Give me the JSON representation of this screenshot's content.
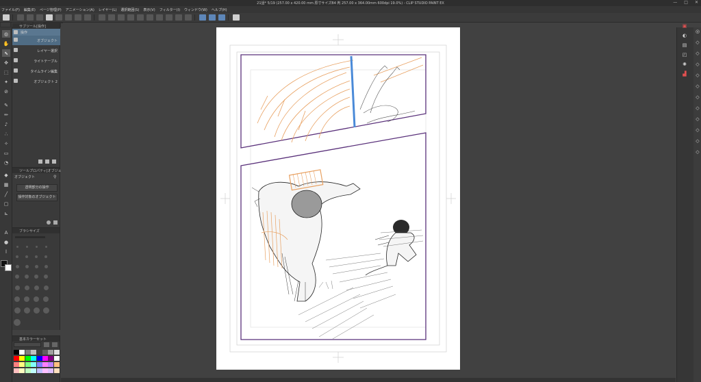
{
  "window": {
    "title": "21話* 5/19 (257.00 x 420.00 mm 原寸サイズB4 判 257.00 x 364.00mm 600dpi 19.0%) - CLIP STUDIO PAINT EX",
    "controls": [
      "—",
      "□",
      "✕"
    ]
  },
  "menu": [
    "ファイル(F)",
    "編集(E)",
    "ページ管理(P)",
    "アニメーション(A)",
    "レイヤー(L)",
    "選択範囲(S)",
    "表示(V)",
    "フィルター(I)",
    "ウィンドウ(W)",
    "ヘルプ(H)"
  ],
  "subtool": {
    "header": "サブツール[操作]",
    "items": [
      {
        "label": "操作"
      },
      {
        "label": "オブジェクト"
      },
      {
        "label": "レイヤー選択"
      },
      {
        "label": "ライトテーブル"
      },
      {
        "label": "タイムライン編集"
      },
      {
        "label": "オブジェクト 2"
      }
    ]
  },
  "toolprop": {
    "header": "ツールプロパティ[オブジェクト]",
    "subheader": "オブジェクト",
    "buttons": [
      "透明部分の操作",
      "操作対象のオブジェクト"
    ]
  },
  "brush": {
    "header": "ブラシサイズ"
  },
  "color": {
    "header": "基本カラーセット",
    "main": "#111111",
    "sub": "#ffffff",
    "swatches": [
      "#000000",
      "#ffffff",
      "#808080",
      "#c0c0c0",
      "#404040",
      "#606060",
      "#a0a0a0",
      "#e0e0e0",
      "#ff0000",
      "#ffff00",
      "#00ff00",
      "#00ffff",
      "#0000ff",
      "#ff00ff",
      "#800080",
      "#ffffff",
      "#ff8080",
      "#ffff80",
      "#80ff80",
      "#80ffff",
      "#8080ff",
      "#ff80ff",
      "#c080ff",
      "#ffc080",
      "#ffc0c0",
      "#ffffc0",
      "#c0ffc0",
      "#c0ffff",
      "#c0c0ff",
      "#ffc0ff",
      "#e0c0ff",
      "#ffe0c0"
    ]
  },
  "theme": {
    "panel_border": "#59307a",
    "sketch_orange": "#e8a060",
    "selection_blue": "#4a8ad8"
  }
}
